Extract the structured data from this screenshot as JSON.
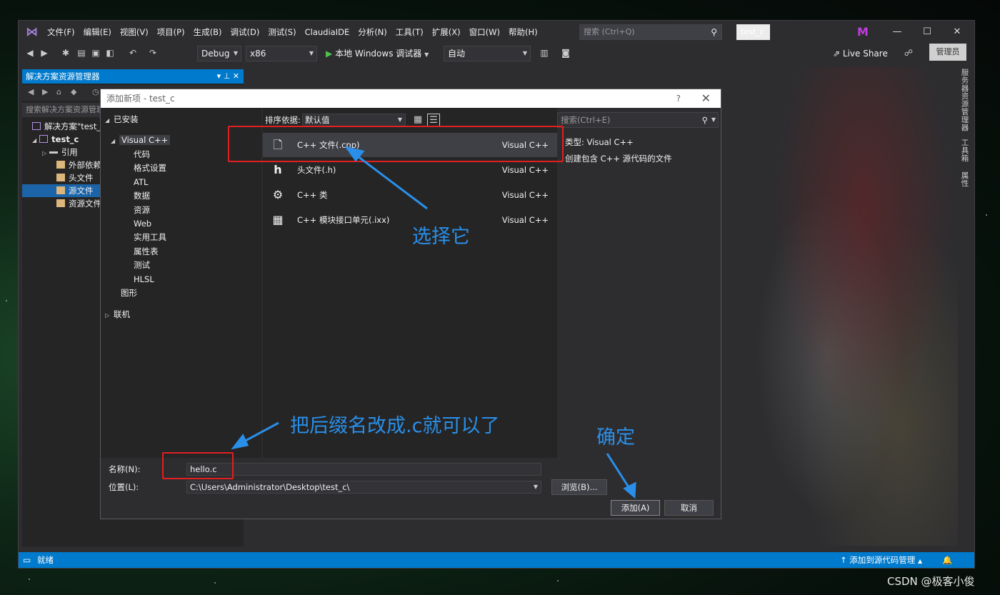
{
  "menubar": {
    "items": [
      "文件(F)",
      "编辑(E)",
      "视图(V)",
      "项目(P)",
      "生成(B)",
      "调试(D)",
      "测试(S)",
      "ClaudiaIDE",
      "分析(N)",
      "工具(T)",
      "扩展(X)",
      "窗口(W)",
      "帮助(H)"
    ],
    "search_placeholder": "搜索 (Ctrl+Q)",
    "solution_badge": "test_c",
    "avatar_initial": "M"
  },
  "toolbar": {
    "config": "Debug",
    "platform": "x86",
    "run_label": "本地 Windows 调试器",
    "auto": "自动",
    "live_share": "Live Share",
    "admin": "管理员"
  },
  "solution_explorer": {
    "title": "解决方案资源管理器",
    "search_placeholder": "搜索解决方案资源管理器",
    "tree": [
      {
        "label": "解决方案\"test_c\""
      },
      {
        "label": "test_c"
      },
      {
        "label": "引用"
      },
      {
        "label": "外部依赖项"
      },
      {
        "label": "头文件"
      },
      {
        "label": "源文件"
      },
      {
        "label": "资源文件"
      }
    ]
  },
  "right_rail": [
    "服务器资源管理器",
    "工具箱",
    "属性"
  ],
  "status": {
    "ready": "就绪",
    "source_control": "添加到源代码管理"
  },
  "dialog": {
    "title": "添加新项 - test_c",
    "help": "?",
    "installed": "已安装",
    "root_category": "Visual C++",
    "categories": [
      "代码",
      "格式设置",
      "ATL",
      "数据",
      "资源",
      "Web",
      "实用工具",
      "属性表",
      "测试",
      "HLSL"
    ],
    "graphics": "图形",
    "online": "联机",
    "sort_label": "排序依据:",
    "sort_value": "默认值",
    "search_placeholder": "搜索(Ctrl+E)",
    "templates": [
      {
        "name": "C++ 文件(.cpp)",
        "lang": "Visual C++",
        "icon": "cpp-file-icon"
      },
      {
        "name": "头文件(.h)",
        "lang": "Visual C++",
        "icon": "header-file-icon"
      },
      {
        "name": "C++ 类",
        "lang": "Visual C++",
        "icon": "class-icon"
      },
      {
        "name": "C++ 模块接口单元(.ixx)",
        "lang": "Visual C++",
        "icon": "module-icon"
      }
    ],
    "type_label": "类型:",
    "type_value": "Visual C++",
    "description": "创建包含 C++ 源代码的文件",
    "name_label": "名称(N):",
    "name_value": "hello.c",
    "location_label": "位置(L):",
    "location_value": "C:\\Users\\Administrator\\Desktop\\test_c\\",
    "browse": "浏览(B)...",
    "add": "添加(A)",
    "cancel": "取消"
  },
  "annotations": {
    "select_it": "选择它",
    "change_suffix": "把后缀名改成.c就可以了",
    "confirm": "确定",
    "color": "#2a8fe8",
    "box_color": "#e02020"
  },
  "watermark": "CSDN @极客小俊"
}
